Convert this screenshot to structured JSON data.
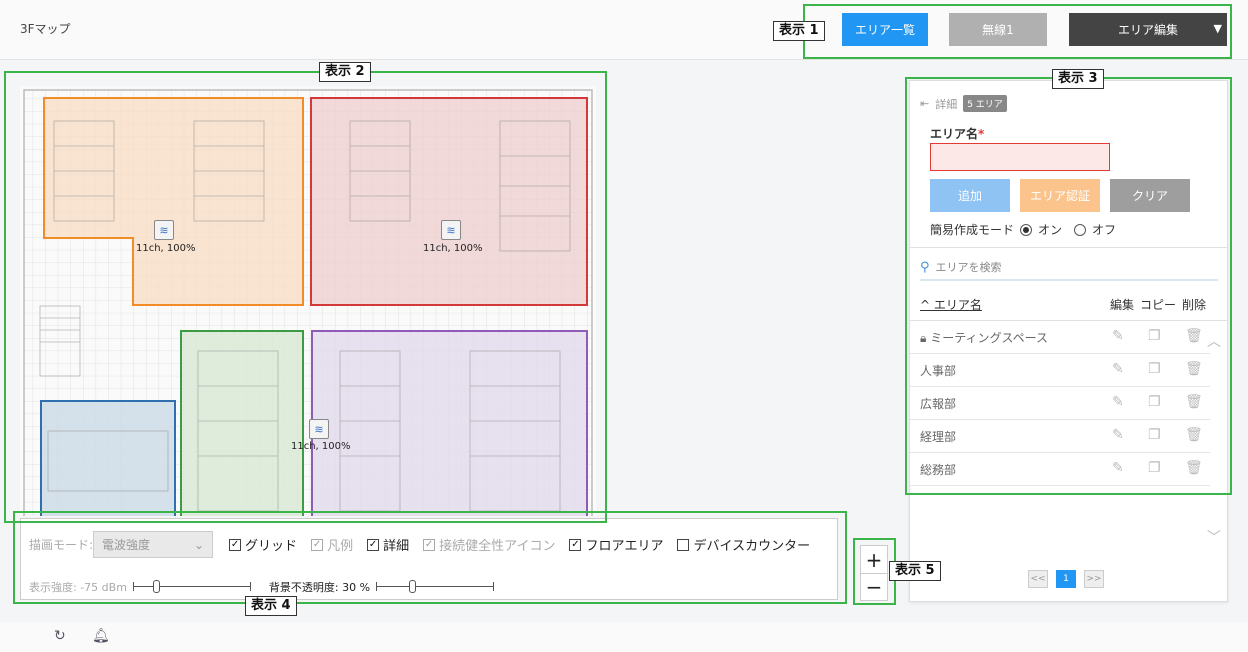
{
  "header": {
    "title": "3Fマップ",
    "btn_area_list": "エリア一覧",
    "btn_wireless": "無線1",
    "btn_area_edit": "エリア編集"
  },
  "callouts": {
    "c1": "表示 1",
    "c2": "表示 2",
    "c3": "表示 3",
    "c4": "表示 4",
    "c5": "表示 5"
  },
  "map": {
    "access_points": [
      {
        "label": "11ch, 100%"
      },
      {
        "label": "11ch, 100%"
      },
      {
        "label": "11ch, 100%"
      }
    ],
    "area_colors": {
      "orange": "#f28c28",
      "red": "#d23a3a",
      "green": "#3d9b45",
      "purple": "#8e5bb8",
      "blue": "#2f6fb0"
    }
  },
  "panel": {
    "back_label": "詳細",
    "badge": "5 エリア",
    "field_label": "エリア名",
    "required_mark": "*",
    "name_value": "",
    "btn_add": "追加",
    "btn_auth": "エリア認証",
    "btn_clear": "クリア",
    "mode_label": "簡易作成モード",
    "mode_on": "オン",
    "mode_off": "オフ",
    "mode_selected": "オン",
    "search_placeholder": "エリアを検索",
    "col_name": "エリア名",
    "col_edit": "編集",
    "col_copy": "コピー",
    "col_delete": "削除",
    "rows": [
      {
        "name": "ミーティングスペース",
        "locked": true
      },
      {
        "name": "人事部",
        "locked": false
      },
      {
        "name": "広報部",
        "locked": false
      },
      {
        "name": "経理部",
        "locked": false
      },
      {
        "name": "総務部",
        "locked": false
      }
    ],
    "pager": {
      "prev": "<<",
      "current": "1",
      "next": ">>"
    }
  },
  "controls": {
    "mode_label": "描画モード:",
    "mode_value": "電波強度",
    "checks": {
      "grid": "グリッド",
      "legend": "凡例",
      "detail": "詳細",
      "health_icon": "接続健全性アイコン",
      "floor_area": "フロアエリア",
      "device_counter": "デバイスカウンター"
    },
    "strength_label": "表示強度: -75 dBm",
    "opacity_label": "背景不透明度: 30 %",
    "opacity_value": 30
  },
  "zoom": {
    "plus": "+",
    "minus": "−"
  }
}
